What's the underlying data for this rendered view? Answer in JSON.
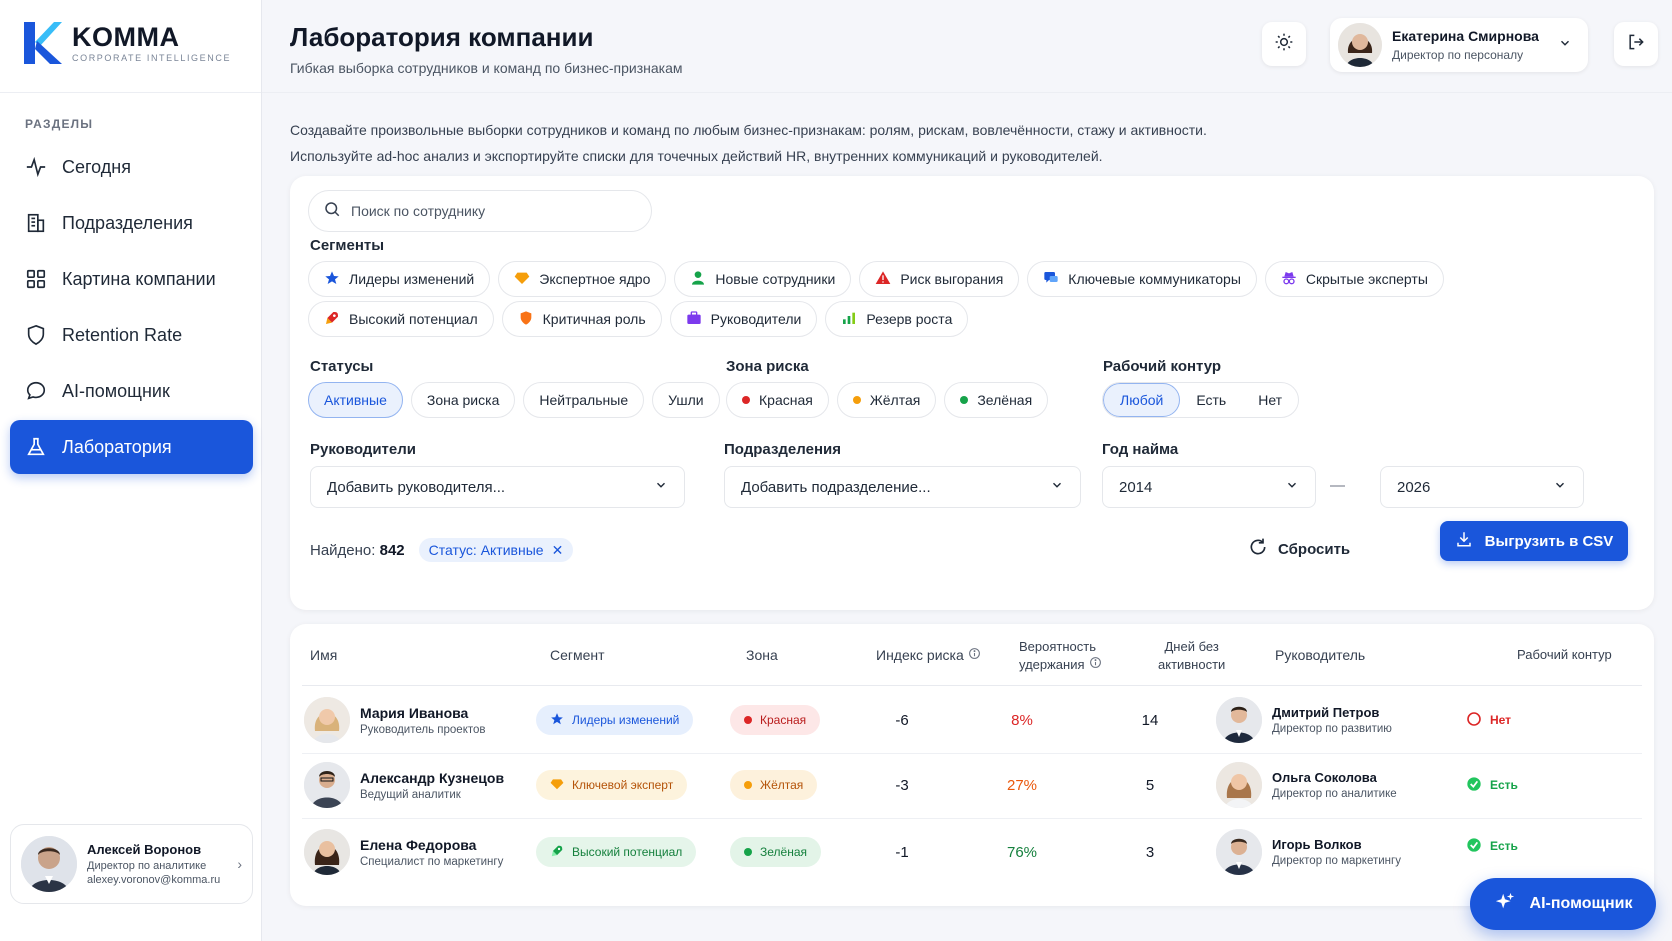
{
  "brand": {
    "name": "KOMMA",
    "tagline": "CORPORATE INTELLIGENCE"
  },
  "sidebar": {
    "section_label": "РАЗДЕЛЫ",
    "items": [
      {
        "label": "Сегодня",
        "icon": "pulse-icon",
        "active": false
      },
      {
        "label": "Подразделения",
        "icon": "building-icon",
        "active": false
      },
      {
        "label": "Картина компании",
        "icon": "grid-icon",
        "active": false
      },
      {
        "label": "Retention Rate",
        "icon": "shield-icon",
        "active": false
      },
      {
        "label": "AI-помощник",
        "icon": "chat-icon",
        "active": false
      },
      {
        "label": "Лаборатория",
        "icon": "flask-icon",
        "active": true
      }
    ],
    "user": {
      "name": "Алексей Воронов",
      "role": "Директор по аналитике",
      "email": "alexey.voronov@komma.ru"
    }
  },
  "header": {
    "title": "Лаборатория компании",
    "subtitle": "Гибкая выборка сотрудников и команд по бизнес-признакам",
    "profile": {
      "name": "Екатерина Смирнова",
      "role": "Директор по персоналу"
    }
  },
  "description": {
    "line1": "Создавайте произвольные выборки сотрудников и команд по любым бизнес-признакам: ролям, рискам, вовлечённости, стажу и активности.",
    "line2": "Используйте ad-hoc анализ и экспортируйте списки для точечных действий HR, внутренних коммуникаций и руководителей."
  },
  "filters": {
    "search_placeholder": "Поиск по сотруднику",
    "segments_label": "Сегменты",
    "segments_row1": [
      "Лидеры изменений",
      "Экспертное ядро",
      "Новые сотрудники",
      "Риск выгорания",
      "Ключевые коммуникаторы",
      "Скрытые эксперты"
    ],
    "segments_row2": [
      "Высокий потенциал",
      "Критичная роль",
      "Руководители",
      "Резерв роста"
    ],
    "statuses_label": "Статусы",
    "statuses": [
      "Активные",
      "Зона риска",
      "Нейтральные",
      "Ушли"
    ],
    "risk_label": "Зона риска",
    "risk_zones": [
      "Красная",
      "Жёлтая",
      "Зелёная"
    ],
    "contour_label": "Рабочий контур",
    "contour": [
      "Любой",
      "Есть",
      "Нет"
    ],
    "managers_label": "Руководители",
    "managers_placeholder": "Добавить руководителя...",
    "departments_label": "Подразделения",
    "departments_placeholder": "Добавить подразделение...",
    "hire_year_label": "Год найма",
    "year_from": "2014",
    "year_dash": "—",
    "year_to": "2026",
    "found_label": "Найдено:",
    "found_count": "842",
    "active_tag": "Статус: Активные",
    "reset_label": "Сбросить",
    "export_label": "Выгрузить в CSV"
  },
  "table": {
    "headers": {
      "name": "Имя",
      "segment": "Сегмент",
      "zone": "Зона",
      "risk_index": "Индекс риска",
      "retention_1": "Вероятность",
      "retention_2": "удержания",
      "inactive_1": "Дней без",
      "inactive_2": "активности",
      "manager": "Руководитель",
      "contour": "Рабочий контур"
    },
    "rows": [
      {
        "name": "Мария Иванова",
        "role": "Руководитель проектов",
        "segment": "Лидеры изменений",
        "zone": "Красная",
        "risk": "-6",
        "retention": "8%",
        "days": "14",
        "manager": "Дмитрий Петров",
        "manager_role": "Директор по развитию",
        "contour": "Нет"
      },
      {
        "name": "Александр Кузнецов",
        "role": "Ведущий аналитик",
        "segment": "Ключевой эксперт",
        "zone": "Жёлтая",
        "risk": "-3",
        "retention": "27%",
        "days": "5",
        "manager": "Ольга Соколова",
        "manager_role": "Директор по аналитике",
        "contour": "Есть"
      },
      {
        "name": "Елена Федорова",
        "role": "Специалист по маркетингу",
        "segment": "Высокий потенциал",
        "zone": "Зелёная",
        "risk": "-1",
        "retention": "76%",
        "days": "3",
        "manager": "Игорь Волков",
        "manager_role": "Директор по маркетингу",
        "contour": "Есть"
      }
    ]
  },
  "ai_button": "AI-помощник",
  "colors": {
    "accent": "#1a56db",
    "red": "#dc2626",
    "yellow": "#f59e0b",
    "green": "#16a34a"
  }
}
